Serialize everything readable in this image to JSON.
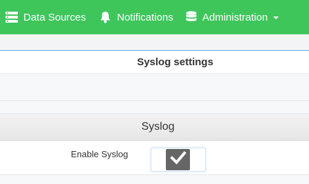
{
  "nav": {
    "items": [
      {
        "label": "Data Sources",
        "icon": "server-icon"
      },
      {
        "label": "Notifications",
        "icon": "bell-icon"
      },
      {
        "label": "Administration",
        "icon": "database-icon",
        "dropdown": true
      }
    ],
    "background": "#3ec65b"
  },
  "panel": {
    "title": "Syslog settings",
    "section": "Syslog",
    "settings": [
      {
        "label": "Enable Syslog",
        "checked": true
      }
    ]
  },
  "colors": {
    "accent_border": "#5ea9e2",
    "checkbox_bg": "#666666"
  }
}
